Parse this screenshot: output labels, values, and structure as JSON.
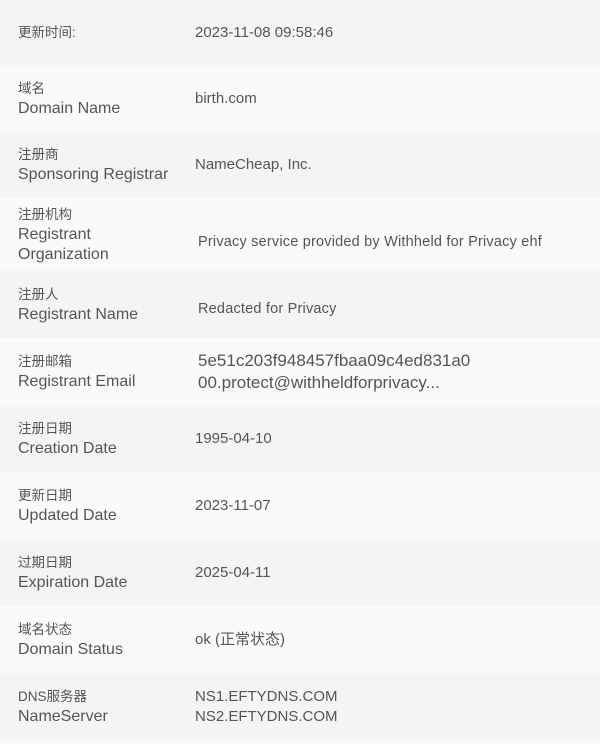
{
  "rows": [
    {
      "zh": "更新时间:",
      "en": "",
      "value": [
        "2023-11-08 09:58:46"
      ]
    },
    {
      "zh": "域名",
      "en": "Domain Name",
      "value": [
        "birth.com"
      ]
    },
    {
      "zh": "注册商",
      "en": "Sponsoring Registrar",
      "value": [
        "NameCheap, Inc."
      ]
    },
    {
      "zh": "注册机构",
      "en": "Registrant Organization",
      "value": [
        "Privacy service provided by Withheld for Privacy ehf"
      ]
    },
    {
      "zh": "注册人",
      "en": "Registrant Name",
      "value": [
        "Redacted for Privacy"
      ]
    },
    {
      "zh": "注册邮箱",
      "en": "Registrant Email",
      "value": [
        "5e51c203f948457fbaa09c4ed831a0",
        "00.protect@withheldforprivacy..."
      ]
    },
    {
      "zh": "注册日期",
      "en": "Creation Date",
      "value": [
        "1995-04-10"
      ]
    },
    {
      "zh": "更新日期",
      "en": "Updated Date",
      "value": [
        "2023-11-07"
      ]
    },
    {
      "zh": "过期日期",
      "en": "Expiration Date",
      "value": [
        "2025-04-11"
      ]
    },
    {
      "zh": "域名状态",
      "en": "Domain Status",
      "value": [
        "ok (正常状态)"
      ]
    },
    {
      "zh": "DNS服务器",
      "en": "NameServer",
      "value": [
        "NS1.EFTYDNS.COM",
        "NS2.EFTYDNS.COM"
      ]
    }
  ]
}
